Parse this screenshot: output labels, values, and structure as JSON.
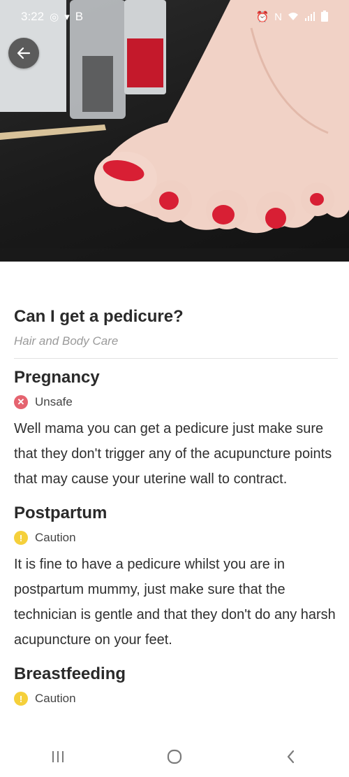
{
  "status_bar": {
    "time": "3:22",
    "left_icons": [
      "gallery-icon",
      "owl-icon",
      "b-badge"
    ],
    "b_label": "B",
    "right_icons": [
      "alarm-icon",
      "nfc-icon",
      "wifi-icon",
      "signal-icon",
      "battery-icon"
    ]
  },
  "header": {
    "back_icon": "arrow-left-icon"
  },
  "article": {
    "title": "Can I get a pedicure?",
    "category": "Hair and Body Care",
    "sections": [
      {
        "heading": "Pregnancy",
        "status": "Unsafe",
        "status_icon": "x-circle-icon",
        "status_color": "#e5636f",
        "body": "Well mama you can get a pedicure just make sure that they don't trigger any of the acupuncture points that may cause your uterine wall to contract."
      },
      {
        "heading": "Postpartum",
        "status": "Caution",
        "status_icon": "exclamation-circle-icon",
        "status_color": "#f5d03b",
        "body": "It is fine to have a pedicure whilst you are in postpartum mummy, just make sure that the technician is gentle and that they don't do any harsh acupuncture on your feet."
      },
      {
        "heading": "Breastfeeding",
        "status": "Caution",
        "status_icon": "exclamation-circle-icon",
        "status_color": "#f5d03b",
        "body": ""
      }
    ]
  },
  "nav": {
    "recents_icon": "recents-icon",
    "home_icon": "home-icon",
    "back_icon": "back-chevron-icon"
  }
}
